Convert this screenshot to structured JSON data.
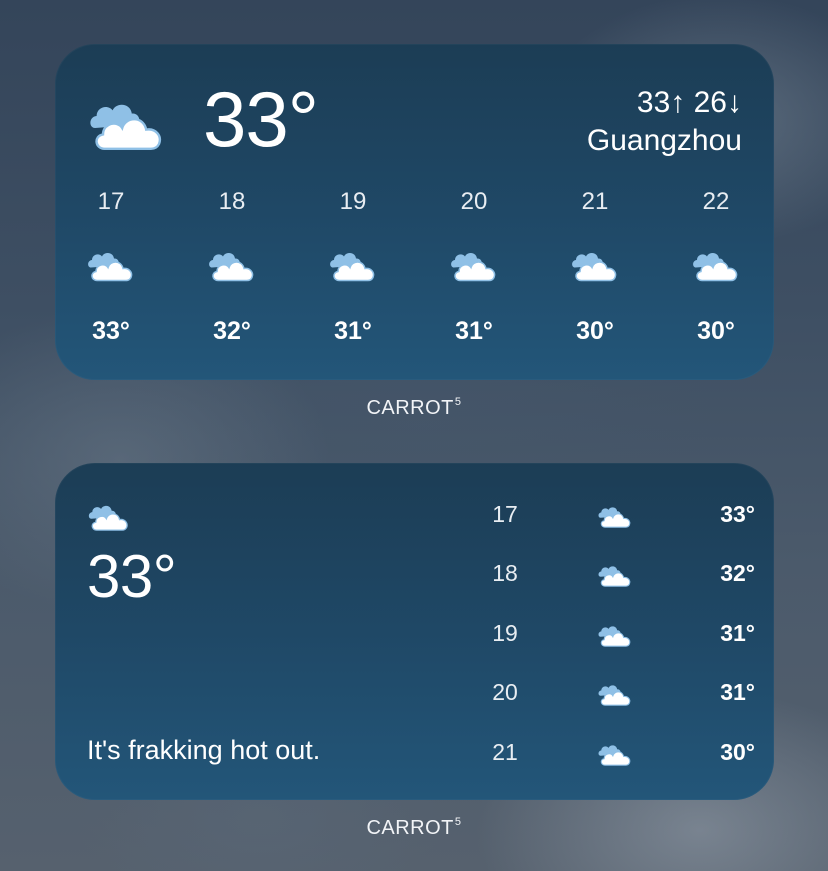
{
  "top_widget": {
    "icon": "cloudy-icon",
    "current_temp": "33°",
    "hi_lo": "33↑ 26↓",
    "city": "Guangzhou",
    "hours": [
      {
        "label": "17",
        "icon": "cloudy-icon",
        "temp": "33°"
      },
      {
        "label": "18",
        "icon": "cloudy-icon",
        "temp": "32°"
      },
      {
        "label": "19",
        "icon": "cloudy-icon",
        "temp": "31°"
      },
      {
        "label": "20",
        "icon": "cloudy-icon",
        "temp": "31°"
      },
      {
        "label": "21",
        "icon": "cloudy-icon",
        "temp": "30°"
      },
      {
        "label": "22",
        "icon": "cloudy-icon",
        "temp": "30°"
      }
    ],
    "caption": "CARROT",
    "caption_superscript": "5"
  },
  "bottom_widget": {
    "icon": "cloudy-icon",
    "current_temp": "33°",
    "message": "It's frakking hot out.",
    "hours": [
      {
        "label": "17",
        "icon": "cloudy-icon",
        "temp": "33°"
      },
      {
        "label": "18",
        "icon": "cloudy-icon",
        "temp": "32°"
      },
      {
        "label": "19",
        "icon": "cloudy-icon",
        "temp": "31°"
      },
      {
        "label": "20",
        "icon": "cloudy-icon",
        "temp": "31°"
      },
      {
        "label": "21",
        "icon": "cloudy-icon",
        "temp": "30°"
      }
    ],
    "caption": "CARROT",
    "caption_superscript": "5"
  },
  "colors": {
    "widget_top": "#1c3d55",
    "widget_bottom": "#235679",
    "cloud_back": "#8fc0e6",
    "cloud_front": "#ffffff"
  }
}
